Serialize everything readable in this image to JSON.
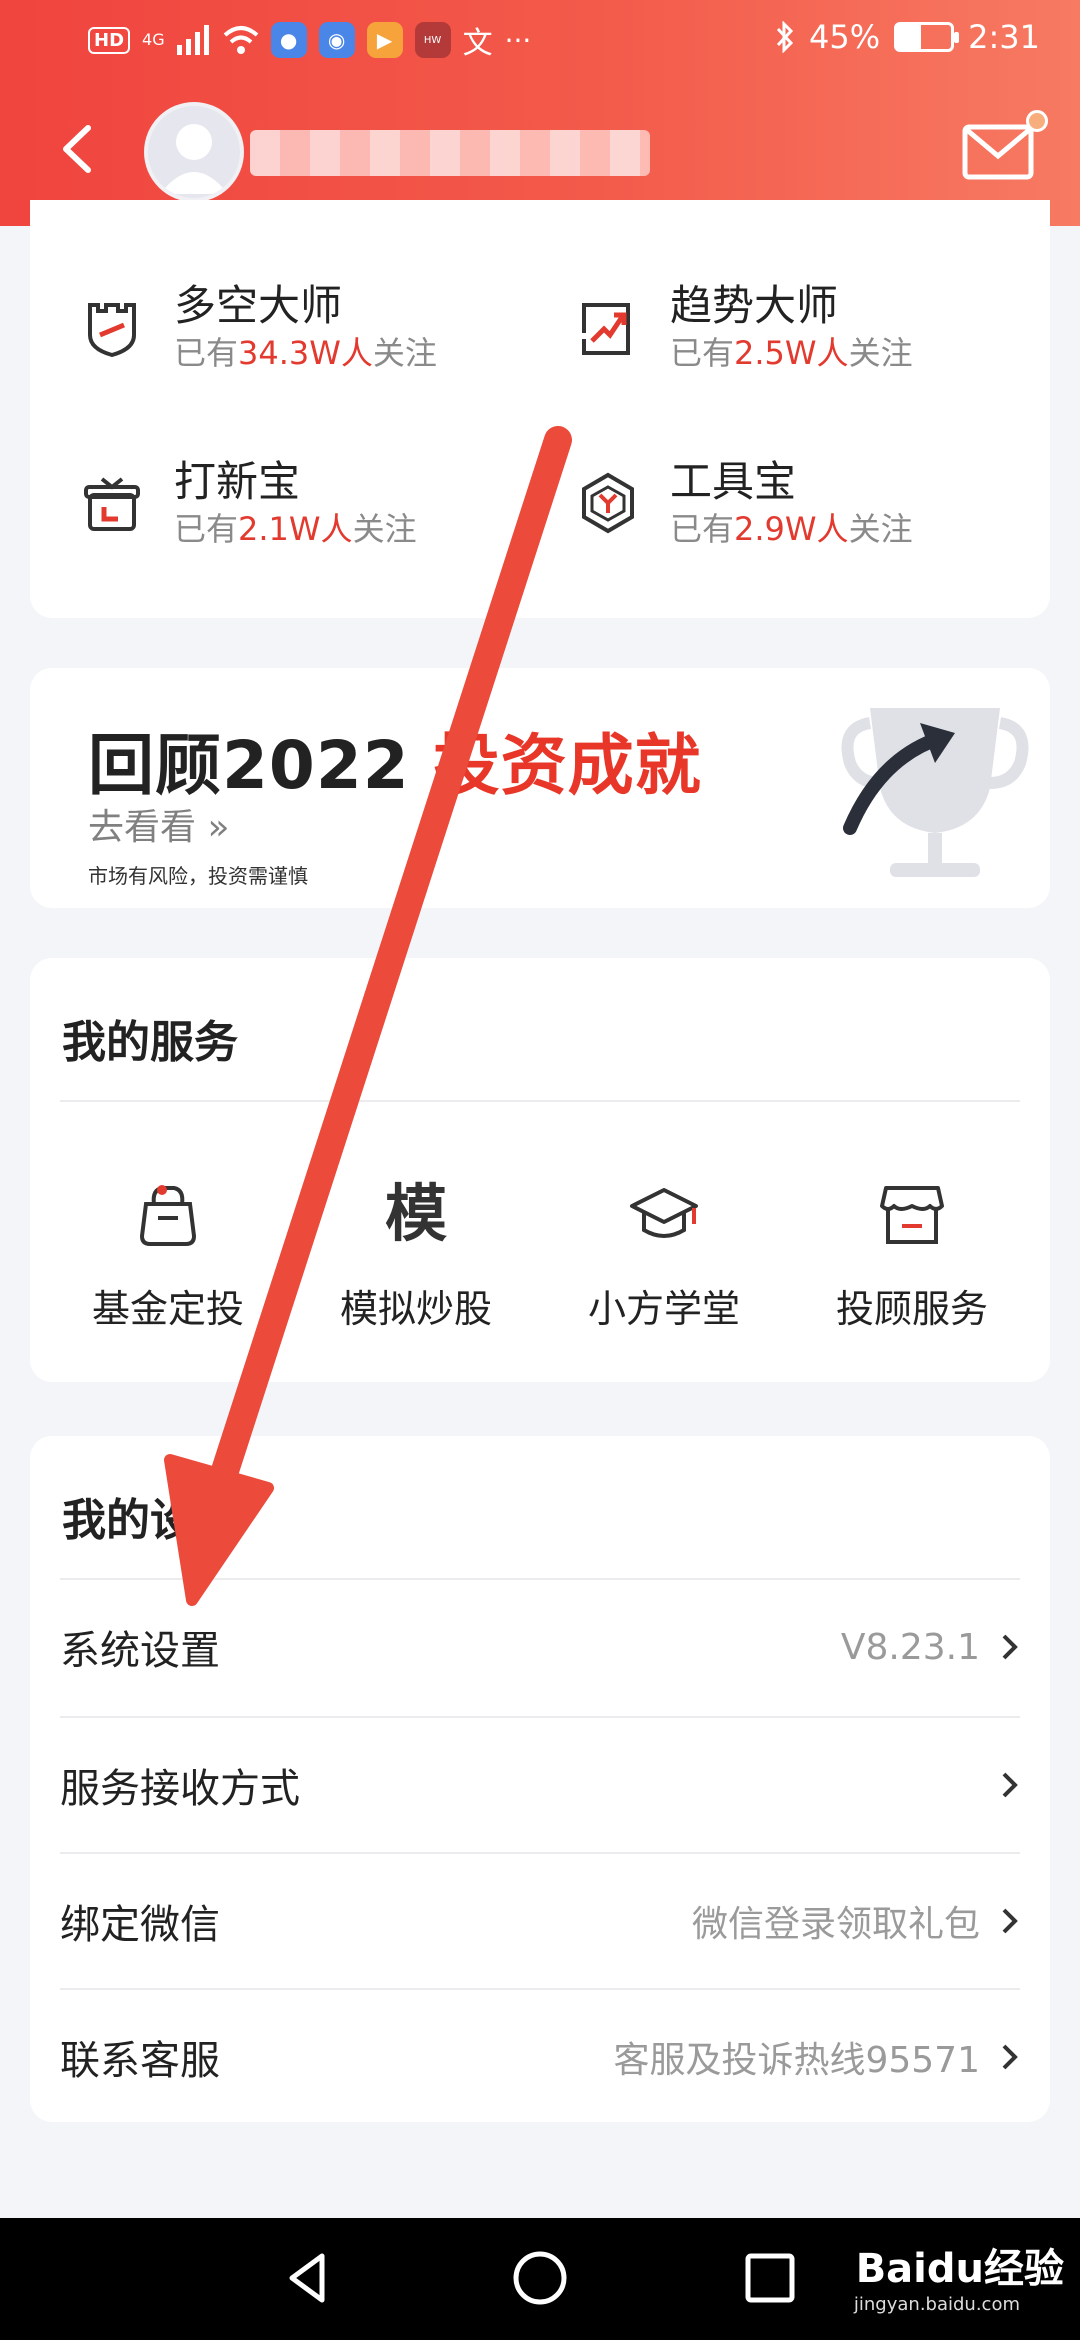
{
  "status_bar": {
    "hd": "HD",
    "network": "4G",
    "bluetooth_icon": "bluetooth-icon",
    "battery": "45%",
    "battery_level": 0.45,
    "time": "2:31"
  },
  "header": {
    "back_icon": "back-arrow-icon",
    "mail_icon": "mail-icon",
    "accent_color": "#f0443e"
  },
  "tools": [
    {
      "title": "多空大师",
      "sub_prefix": "已有",
      "count": "34.3W人",
      "sub_suffix": "关注",
      "icon": "castle-shield-icon"
    },
    {
      "title": "趋势大师",
      "sub_prefix": "已有",
      "count": "2.5W人",
      "sub_suffix": "关注",
      "icon": "trend-chart-icon"
    },
    {
      "title": "打新宝",
      "sub_prefix": "已有",
      "count": "2.1W人",
      "sub_suffix": "关注",
      "icon": "gift-box-icon"
    },
    {
      "title": "工具宝",
      "sub_prefix": "已有",
      "count": "2.9W人",
      "sub_suffix": "关注",
      "icon": "hexagon-y-icon"
    }
  ],
  "banner": {
    "title_black": "回顾2022 ",
    "title_red": "投资成就",
    "link": "去看看 »",
    "risk": "市场有风险，投资需谨慎",
    "icon": "trophy-icon"
  },
  "services": {
    "title": "我的服务",
    "items": [
      {
        "label": "基金定投",
        "icon": "piggy-bag-icon"
      },
      {
        "label": "模拟炒股",
        "icon": "mo-character-icon",
        "char": "模"
      },
      {
        "label": "小方学堂",
        "icon": "graduation-cap-icon"
      },
      {
        "label": "投顾服务",
        "icon": "store-icon"
      }
    ]
  },
  "settings": {
    "title": "我的设置",
    "rows": [
      {
        "label": "系统设置",
        "value": "V8.23.1"
      },
      {
        "label": "服务接收方式",
        "value": ""
      },
      {
        "label": "绑定微信",
        "value": "微信登录领取礼包"
      },
      {
        "label": "联系客服",
        "value": "客服及投诉热线95571"
      }
    ]
  },
  "nav": {
    "back_icon": "nav-back-icon",
    "home_icon": "nav-home-icon",
    "recents_icon": "nav-recents-icon",
    "watermark": "Baidu经验",
    "watermark_sub": "jingyan.baidu.com"
  }
}
